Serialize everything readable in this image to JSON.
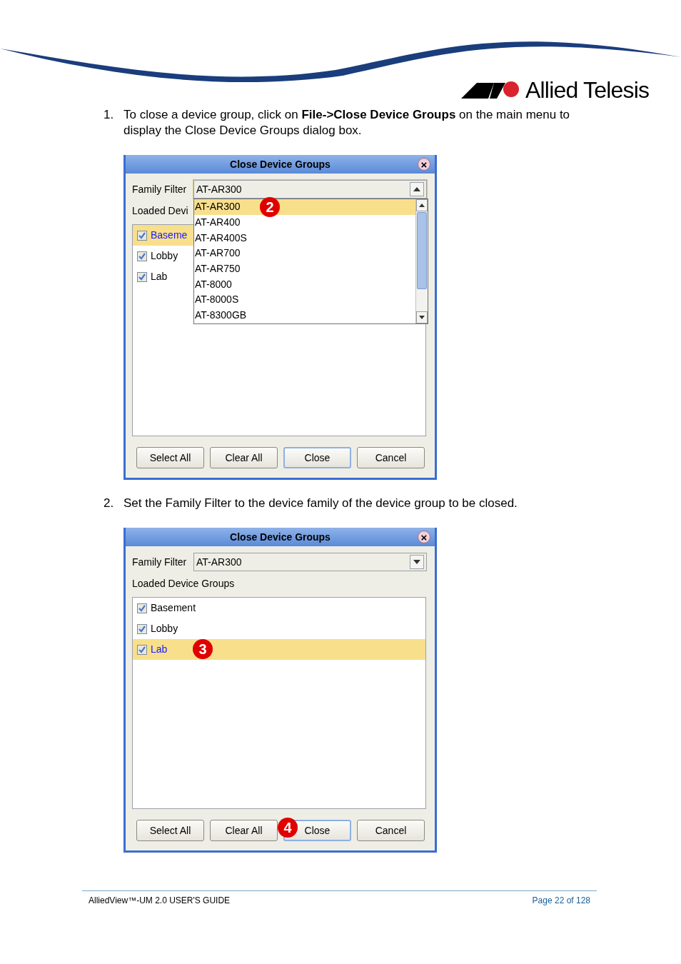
{
  "header": {
    "logo_text": "Allied Telesis"
  },
  "steps": [
    {
      "number": "1.",
      "text": "To close a device group, click on **File->Close Device Groups** on the main menu to display the Close Device Groups dialog box.",
      "dialog": {
        "title": "Close Device Groups",
        "close_glyph": "×",
        "family_filter": {
          "label": "Family Filter",
          "value": "AT-AR300",
          "expanded": true,
          "options": [
            {
              "label": "AT-AR300",
              "selected": true,
              "callout": "2"
            },
            {
              "label": "AT-AR400",
              "selected": false
            },
            {
              "label": "AT-AR400S",
              "selected": false
            },
            {
              "label": "AT-AR700",
              "selected": false
            },
            {
              "label": "AT-AR750",
              "selected": false
            },
            {
              "label": "AT-8000",
              "selected": false
            },
            {
              "label": "AT-8000S",
              "selected": false
            },
            {
              "label": "AT-8300GB",
              "selected": false
            }
          ]
        },
        "groups_label": "Loaded Devi",
        "groups": [
          {
            "label": "Baseme",
            "checked": true,
            "selected": true
          },
          {
            "label": "Lobby",
            "checked": true,
            "selected": false
          },
          {
            "label": "Lab",
            "checked": true,
            "selected": false
          }
        ],
        "buttons": [
          {
            "label": "Select All",
            "default": false
          },
          {
            "label": "Clear All",
            "default": false
          },
          {
            "label": "Close",
            "default": true
          },
          {
            "label": "Cancel",
            "default": false
          }
        ]
      }
    },
    {
      "number": "2.",
      "text": "Set the Family Filter to the device family of the device group to be closed.",
      "dialog": {
        "title": "Close Device Groups",
        "close_glyph": "×",
        "family_filter": {
          "label": "Family Filter",
          "value": "AT-AR300",
          "expanded": false
        },
        "groups_label": "Loaded Device Groups",
        "groups": [
          {
            "label": "Basement",
            "checked": true,
            "selected": false
          },
          {
            "label": "Lobby",
            "checked": true,
            "selected": false
          },
          {
            "label": "Lab",
            "checked": true,
            "selected": true,
            "callout": "3"
          }
        ],
        "buttons": [
          {
            "label": "Select All",
            "default": false
          },
          {
            "label": "Clear All",
            "default": false
          },
          {
            "label": "Close",
            "default": true,
            "callout": "4"
          },
          {
            "label": "Cancel",
            "default": false
          }
        ]
      }
    }
  ],
  "footer": {
    "left": "AlliedView™-UM 2.0 USER'S GUIDE",
    "right": "Page 22 of 128"
  }
}
